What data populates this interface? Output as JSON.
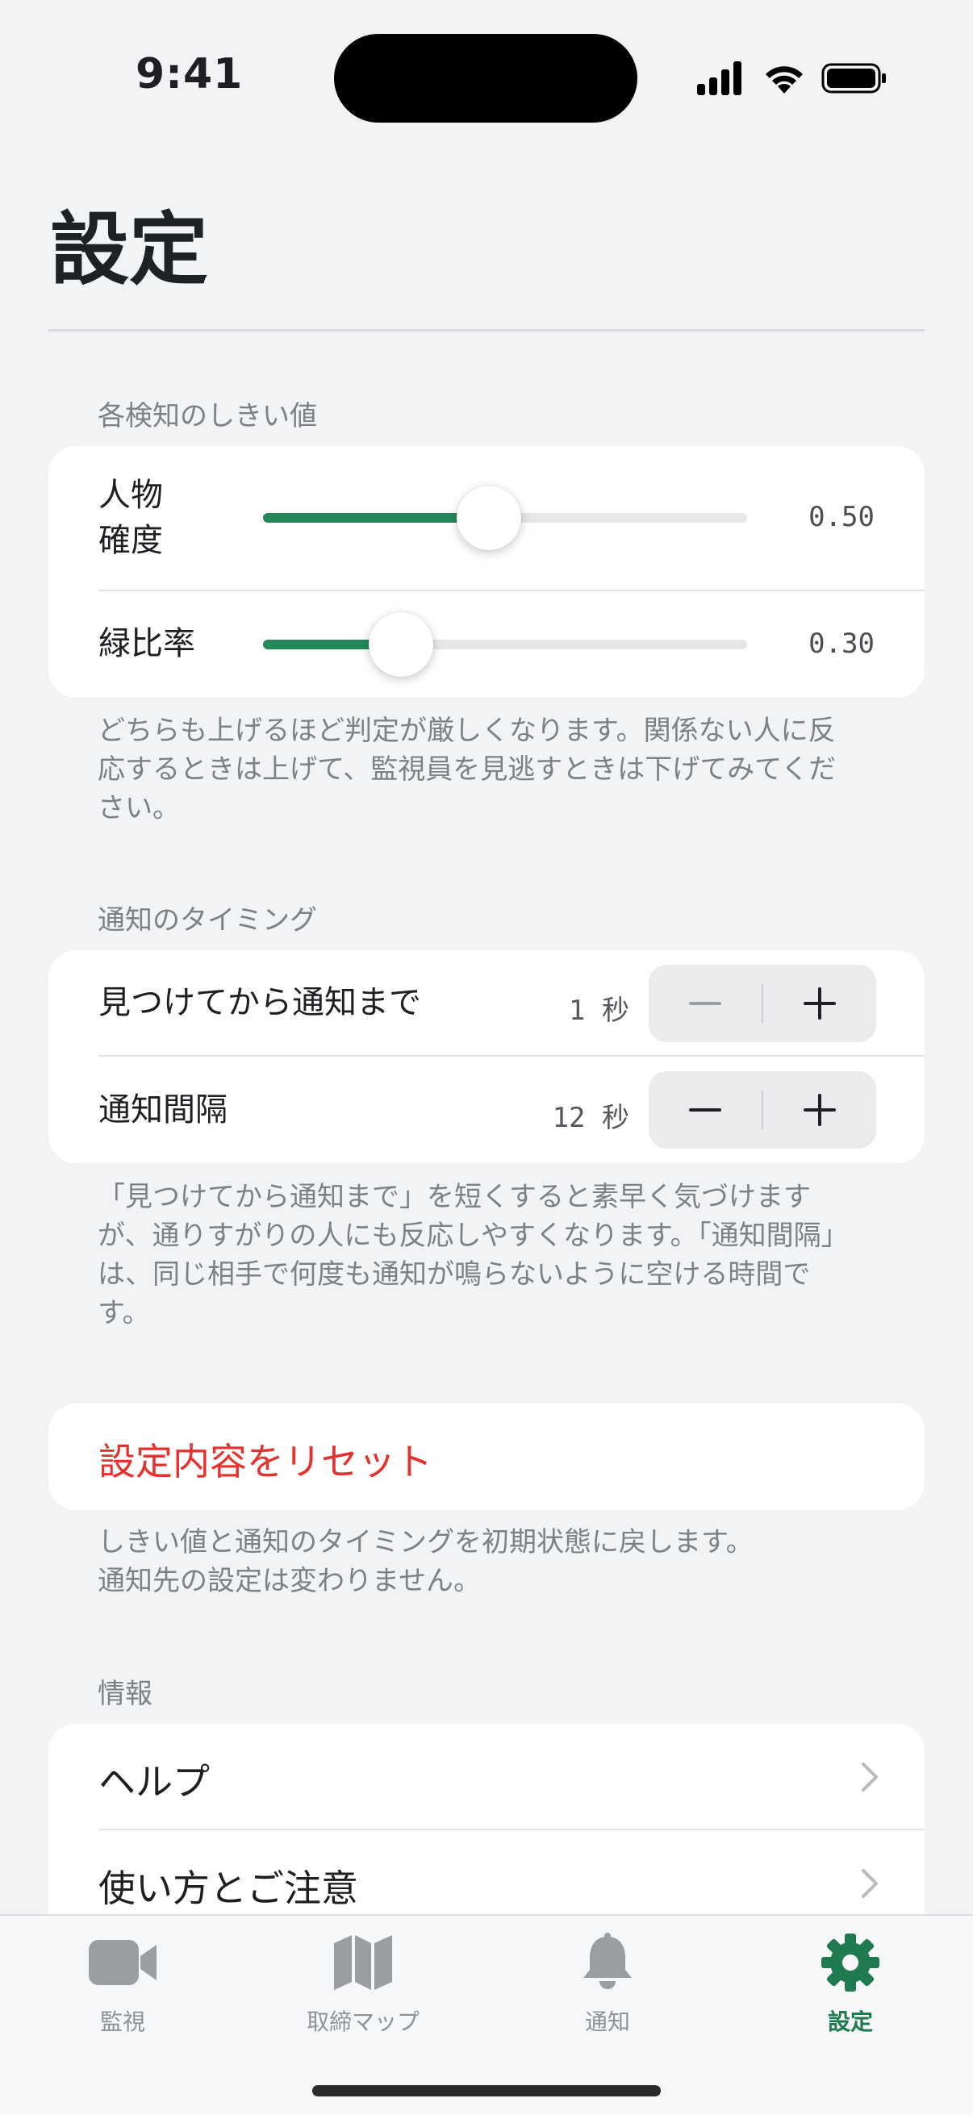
{
  "status_bar": {
    "time": "9:41"
  },
  "page": {
    "title": "設定"
  },
  "thresholds": {
    "header": "各検知のしきい値",
    "items": [
      {
        "label": "人物\n確度",
        "value": 0.5,
        "value_text": "0.50"
      },
      {
        "label": "緑比率",
        "value": 0.3,
        "value_text": "0.30"
      }
    ],
    "footer": "どちらも上げるほど判定が厳しくなります。関係ない人に反応するときは上げて、監視員を見逃すときは下げてみてください。"
  },
  "timing": {
    "header": "通知のタイミング",
    "items": [
      {
        "label": "見つけてから通知まで",
        "value_text": "1 秒"
      },
      {
        "label": "通知間隔",
        "value_text": "12 秒"
      }
    ],
    "footer": "「見つけてから通知まで」を短くすると素早く気づけますが、通りすがりの人にも反応しやすくなります。「通知間隔」は、同じ相手で何度も通知が鳴らないように空ける時間です。"
  },
  "reset": {
    "label": "設定内容をリセット",
    "footer": "しきい値と通知のタイミングを初期状態に戻します。\n通知先の設定は変わりません。"
  },
  "info": {
    "header": "情報",
    "items": [
      {
        "label": "ヘルプ"
      },
      {
        "label": "使い方とご注意"
      }
    ]
  },
  "tabs": [
    {
      "label": "監視",
      "icon": "video-camera-icon",
      "active": false
    },
    {
      "label": "取締マップ",
      "icon": "map-icon",
      "active": false
    },
    {
      "label": "通知",
      "icon": "bell-icon",
      "active": false
    },
    {
      "label": "設定",
      "icon": "gear-icon",
      "active": true
    }
  ],
  "colors": {
    "accent": "#23895a",
    "tab_active": "#1f7a4f",
    "destructive": "#e5322d",
    "background": "#f2f3f5"
  }
}
